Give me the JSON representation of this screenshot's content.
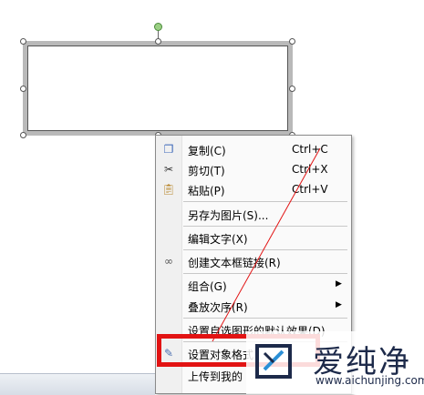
{
  "menu": {
    "items": [
      {
        "label": "复制(C)",
        "shortcut": "Ctrl+C",
        "icon": "copy-icon"
      },
      {
        "label": "剪切(T)",
        "shortcut": "Ctrl+X",
        "icon": "scissors-icon"
      },
      {
        "label": "粘贴(P)",
        "shortcut": "Ctrl+V",
        "icon": "clipboard-icon"
      },
      {
        "label": "另存为图片(S)..."
      },
      {
        "label": "编辑文字(X)"
      },
      {
        "label": "创建文本框链接(R)",
        "icon": "link-icon"
      },
      {
        "label": "组合(G)"
      },
      {
        "label": "叠放次序(R)"
      },
      {
        "label": "设置自选图形的默认效果(D)"
      },
      {
        "label": "设置对象格式",
        "icon": "format-icon"
      },
      {
        "label": "上传到我的"
      }
    ],
    "submenu_arrow": "▶"
  },
  "watermark": {
    "brand": "爱纯净",
    "url": "www.aichunjing.com"
  },
  "colors": {
    "annotation": "#e21313",
    "menu_bg": "#fafafa",
    "selection_handle": "#ffffff"
  }
}
